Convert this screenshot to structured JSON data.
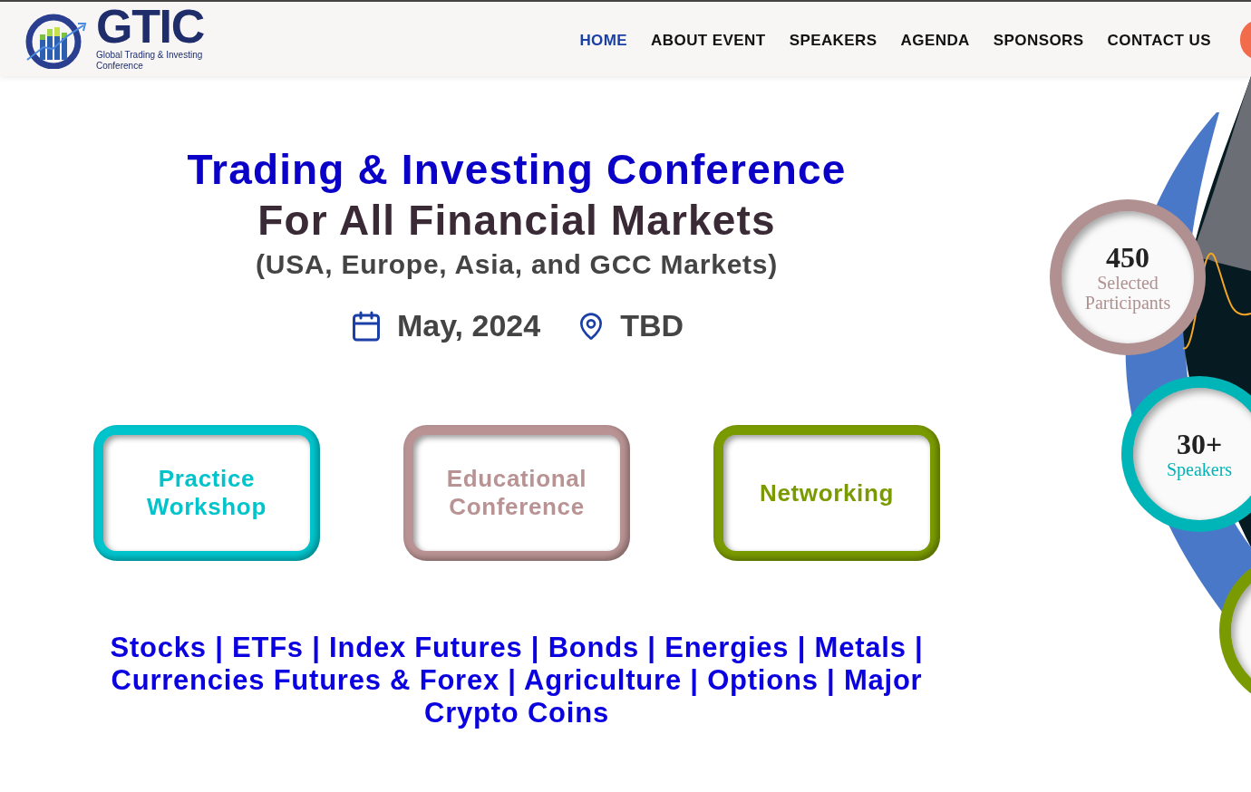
{
  "header": {
    "logo": {
      "mark": "GTIC",
      "tagline": "Global Trading & Investing Conference"
    },
    "nav": [
      {
        "label": "HOME",
        "selected": true
      },
      {
        "label": "ABOUT EVENT",
        "selected": false
      },
      {
        "label": "SPEAKERS",
        "selected": false
      },
      {
        "label": "AGENDA",
        "selected": false
      },
      {
        "label": "SPONSORS",
        "selected": false
      },
      {
        "label": "CONTACT US",
        "selected": false
      }
    ]
  },
  "hero": {
    "title_line_1": "Trading & Investing Conference",
    "title_line_2": "For All Financial Markets",
    "subtitle": "(USA, Europe, Asia, and GCC Markets)",
    "date": "May, 2024",
    "location": "TBD"
  },
  "cards": [
    {
      "label": "Practice Workshop",
      "color": "#00c4cc"
    },
    {
      "label": "Educational Conference",
      "color": "#b99393"
    },
    {
      "label": "Networking",
      "color": "#7a9a01"
    }
  ],
  "markets": "Stocks | ETFs | Index Futures | Bonds | Energies | Metals | Currencies Futures & Forex | Agriculture | Options | Major Crypto Coins",
  "stats": [
    {
      "number": "450",
      "label": "Selected Participants",
      "color": "#b09090"
    },
    {
      "number": "30+",
      "label": "Speakers",
      "color": "#00b5b8"
    },
    {
      "color": "#7a9a01"
    }
  ]
}
